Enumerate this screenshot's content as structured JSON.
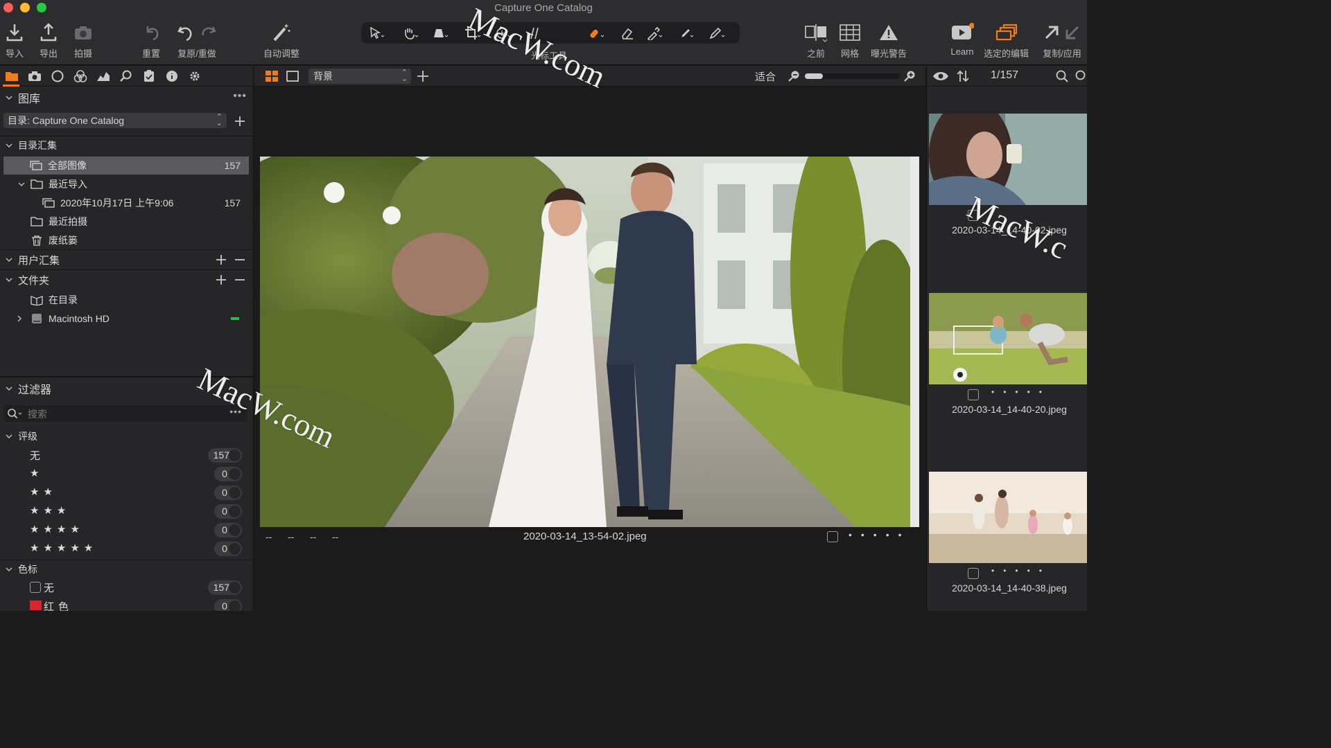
{
  "window": {
    "title": "Capture One Catalog"
  },
  "toolbar": {
    "import": "导入",
    "export": "导出",
    "capture": "拍摄",
    "reset": "重置",
    "undo_redo": "复原/重做",
    "auto_adjust": "自动调整",
    "cursor_tools": "光标工具",
    "before": "之前",
    "grid": "网格",
    "exposure_warning": "曝光警告",
    "learn": "Learn",
    "edit_selected": "选定的编辑",
    "copy_apply": "复制/应用"
  },
  "library": {
    "title": "图库",
    "catalog_select": "目录: Capture One Catalog",
    "catalog_collections": "目录汇集",
    "all_images": {
      "label": "全部图像",
      "count": "157"
    },
    "recent_imports": "最近导入",
    "import_item": {
      "label": "2020年10月17日 上午9:06",
      "count": "157"
    },
    "recent_captures": "最近拍摄",
    "trash": "废纸篓",
    "user_collections": "用户汇集",
    "folders": "文件夹",
    "in_catalog": "在目录",
    "macintosh_hd": "Macintosh HD"
  },
  "filters": {
    "title": "过滤器",
    "search_placeholder": "搜索",
    "rating_title": "评级",
    "ratings": [
      {
        "label": "无",
        "count": "157"
      },
      {
        "label": "★",
        "count": "0"
      },
      {
        "label": "★★",
        "count": "0"
      },
      {
        "label": "★★★",
        "count": "0"
      },
      {
        "label": "★★★★",
        "count": "0"
      },
      {
        "label": "★★★★★",
        "count": "0"
      }
    ],
    "color_tag_title": "色标",
    "color_tags": [
      {
        "label": "无",
        "count": "157"
      },
      {
        "label": "红色",
        "count": "0"
      }
    ]
  },
  "viewer": {
    "background_select": "背景",
    "zoom_label": "适合",
    "zoom_level": 0.19,
    "meta_placeholders": [
      "--",
      "--",
      "--",
      "--"
    ],
    "filename": "2020-03-14_13-54-02.jpeg"
  },
  "browser": {
    "counter": "1/157",
    "thumbnails": [
      {
        "filename": "2020-03-14_14-40-02.jpeg"
      },
      {
        "filename": "2020-03-14_14-40-20.jpeg"
      },
      {
        "filename": "2020-03-14_14-40-38.jpeg"
      }
    ]
  },
  "watermarks": [
    "MacW.com",
    "MacW.com",
    "MacW.c"
  ],
  "colors": {
    "accent": "#f07d1a",
    "panel": "#262628",
    "viewer_bg": "#1b1b1c",
    "selected_row": "#5a5a5c",
    "volume_indicator": "#23c140"
  }
}
